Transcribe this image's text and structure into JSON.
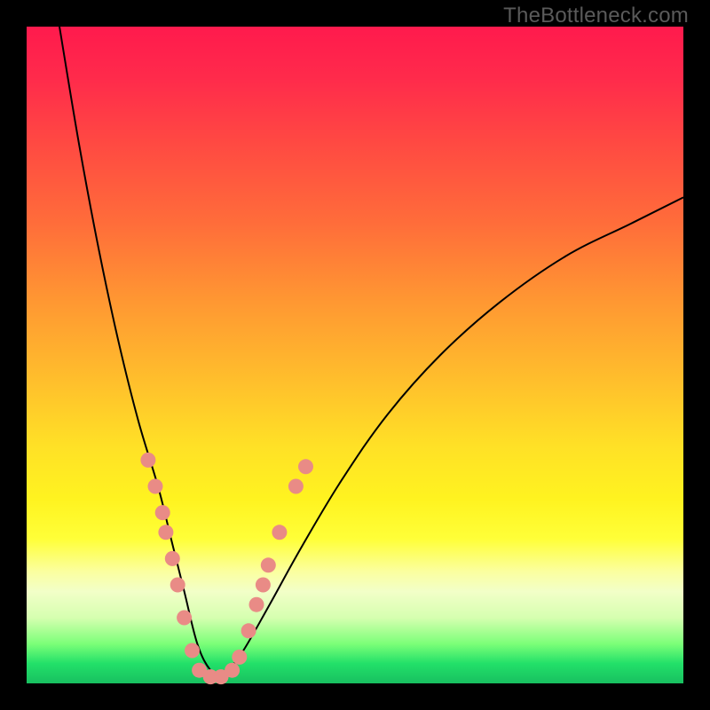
{
  "watermark": "TheBottleneck.com",
  "colors": {
    "background_frame": "#000000",
    "gradient_top": "#ff1a4d",
    "gradient_mid1": "#ff9832",
    "gradient_mid2": "#ffe126",
    "gradient_light_band": "#f2ffc8",
    "gradient_bottom": "#18c060",
    "curve": "#000000",
    "dots": "#e98b86"
  },
  "chart_data": {
    "type": "line",
    "title": "",
    "xlabel": "",
    "ylabel": "",
    "xlim": [
      0,
      100
    ],
    "ylim": [
      0,
      100
    ],
    "notes": "Bottleneck-style V curve over a rainbow gradient. Y decreases downward in the image; values below are approximate percentages in plot-area coords (x across, y top→bottom). Curve reaches near-bottom around x≈26–32. Salmon dots overlay both arms of the V in the lower portion.",
    "series": [
      {
        "name": "left-arm",
        "x": [
          5,
          8,
          11,
          14,
          17,
          20,
          22,
          24,
          26,
          28,
          30
        ],
        "y": [
          0,
          18,
          34,
          48,
          60,
          70,
          78,
          86,
          94,
          98,
          99
        ]
      },
      {
        "name": "right-arm",
        "x": [
          30,
          33,
          37,
          42,
          48,
          55,
          63,
          72,
          82,
          92,
          100
        ],
        "y": [
          99,
          95,
          88,
          79,
          69,
          59,
          50,
          42,
          35,
          30,
          26
        ]
      }
    ],
    "dots": [
      {
        "x": 18.5,
        "y": 66
      },
      {
        "x": 19.6,
        "y": 70
      },
      {
        "x": 20.7,
        "y": 74
      },
      {
        "x": 21.2,
        "y": 77
      },
      {
        "x": 22.2,
        "y": 81
      },
      {
        "x": 23.0,
        "y": 85
      },
      {
        "x": 24.0,
        "y": 90
      },
      {
        "x": 25.2,
        "y": 95
      },
      {
        "x": 26.3,
        "y": 98
      },
      {
        "x": 28.0,
        "y": 99
      },
      {
        "x": 29.6,
        "y": 99
      },
      {
        "x": 31.3,
        "y": 98
      },
      {
        "x": 32.4,
        "y": 96
      },
      {
        "x": 33.8,
        "y": 92
      },
      {
        "x": 35.0,
        "y": 88
      },
      {
        "x": 36.0,
        "y": 85
      },
      {
        "x": 36.8,
        "y": 82
      },
      {
        "x": 38.5,
        "y": 77
      },
      {
        "x": 41.0,
        "y": 70
      },
      {
        "x": 42.5,
        "y": 67
      }
    ]
  }
}
